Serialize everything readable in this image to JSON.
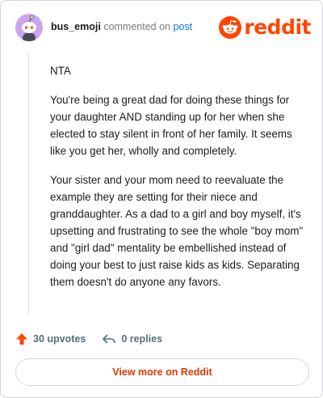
{
  "header": {
    "username": "bus_emoji",
    "commented_on": "commented on",
    "post_link": "post",
    "logo_text": "reddit"
  },
  "comment": {
    "paragraphs": [
      "NTA",
      "You're being a great dad for doing these things for your daughter AND standing up for her when she elected to stay silent in front of her family. It seems like you get her, wholly and completely.",
      "Your sister and your mom need to reevaluate the example they are setting for their niece and granddaughter. As a dad to a girl and boy myself, it's upsetting and frustrating to see the whole \"boy mom\" and \"girl dad\" mentality be embellished instead of doing your best to just raise kids as kids. Separating them doesn't do anyone any favors."
    ]
  },
  "actions": {
    "upvotes": "30 upvotes",
    "replies": "0 replies"
  },
  "footer": {
    "view_more": "View more on Reddit"
  },
  "colors": {
    "accent": "#ff4500",
    "link": "#0079d3",
    "button_text": "#d93a00",
    "avatar_bg": "#c7a6ec"
  }
}
